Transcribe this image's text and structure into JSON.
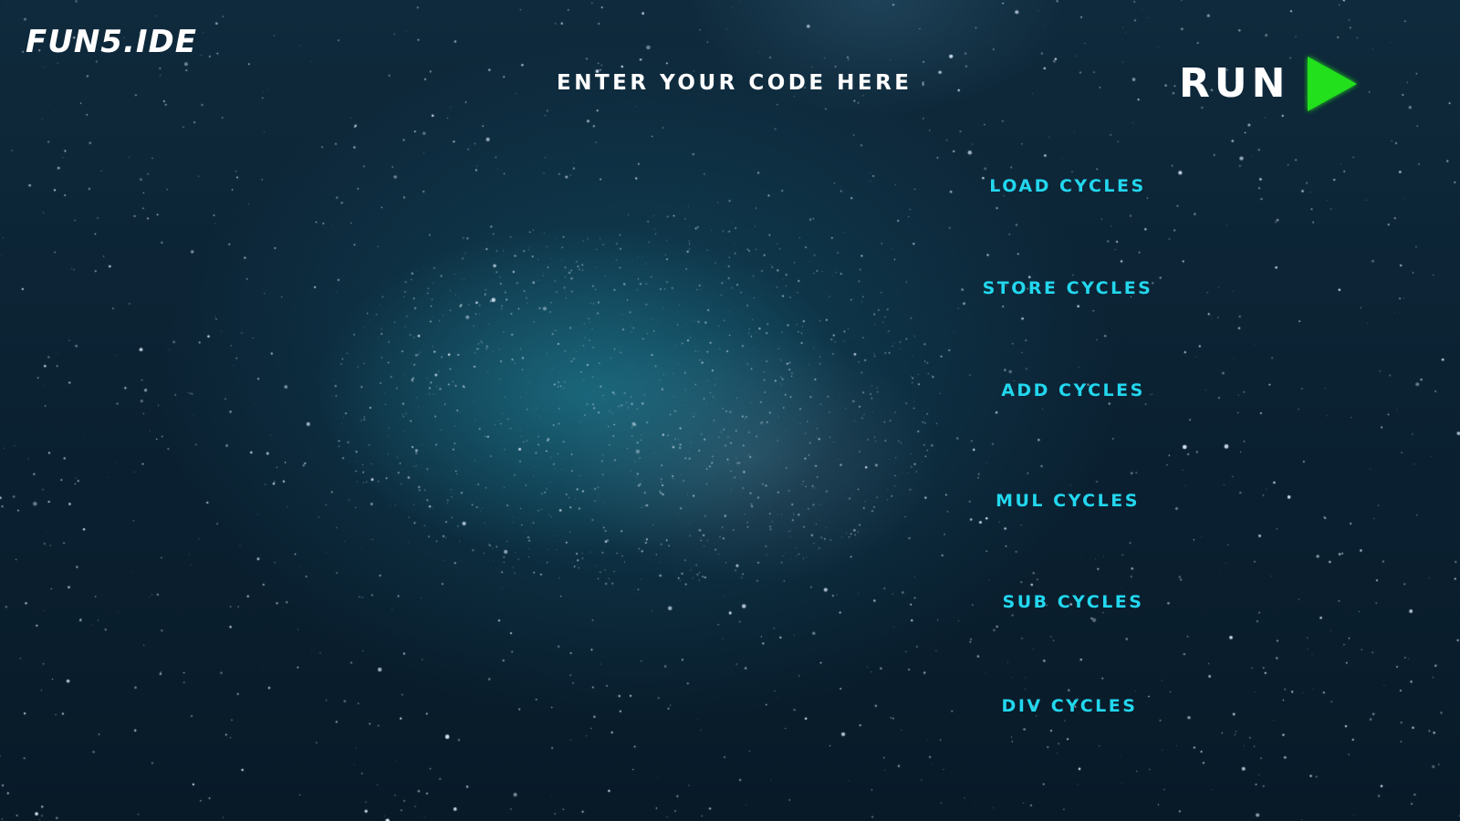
{
  "app": {
    "logo": "FUN5.IDE"
  },
  "editor": {
    "prompt": "ENTER YOUR CODE HERE"
  },
  "run": {
    "label": "RUN",
    "icon": "play-icon",
    "icon_color": "#22e01a"
  },
  "cycles": [
    {
      "label": "LOAD CYCLES"
    },
    {
      "label": "STORE CYCLES"
    },
    {
      "label": "ADD CYCLES"
    },
    {
      "label": "MUL CYCLES"
    },
    {
      "label": "SUB CYCLES"
    },
    {
      "label": "DIV CYCLES"
    }
  ],
  "colors": {
    "accent": "#22d7ee",
    "text": "#ffffff",
    "background": "#0b2233"
  }
}
